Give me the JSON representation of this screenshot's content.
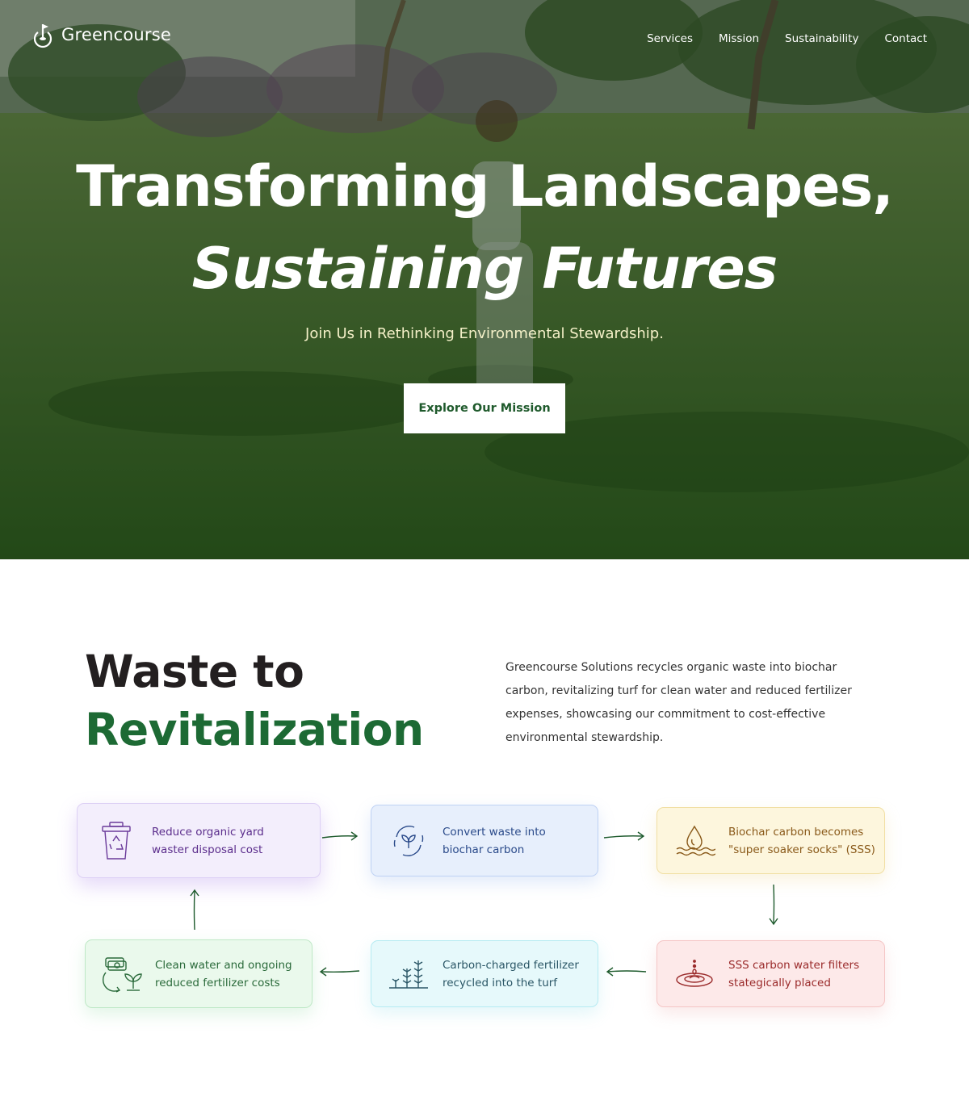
{
  "brand": {
    "name": "Greencourse"
  },
  "nav": {
    "items": [
      "Services",
      "Mission",
      "Sustainability",
      "Contact"
    ]
  },
  "hero": {
    "title_line1": "Transforming Landscapes,",
    "title_line2": "Sustaining Futures",
    "subtitle": "Join Us in Rethinking Environmental Stewardship.",
    "cta_label": "Explore Our Mission"
  },
  "waste": {
    "title_line1": "Waste to",
    "title_line2": "Revitalization",
    "description": "Greencourse Solutions recycles organic waste into biochar carbon, revitalizing turf for clean water and reduced fertilizer expenses, showcasing our commitment to cost-effective environmental stewardship.",
    "steps": [
      {
        "label_l1": "Reduce organic yard",
        "label_l2": "waster disposal cost",
        "icon": "recycle-bin-icon",
        "color": "#5b2d8c"
      },
      {
        "label_l1": "Convert waste into",
        "label_l2": "biochar carbon",
        "icon": "leaf-cycle-icon",
        "color": "#2a4a8a"
      },
      {
        "label_l1": "Biochar carbon becomes",
        "label_l2": "\"super soaker socks\" (SSS)",
        "icon": "water-drop-icon",
        "color": "#8a5a1a"
      },
      {
        "label_l1": "SSS carbon water filters",
        "label_l2": "stategically placed",
        "icon": "water-ripple-icon",
        "color": "#9a2a2a"
      },
      {
        "label_l1": "Carbon-charged fertilizer",
        "label_l2": "recycled into the turf",
        "icon": "plants-icon",
        "color": "#2a5666"
      },
      {
        "label_l1": "Clean water and ongoing",
        "label_l2": "reduced fertilizer costs",
        "icon": "money-plant-icon",
        "color": "#2a6a3a"
      }
    ]
  }
}
